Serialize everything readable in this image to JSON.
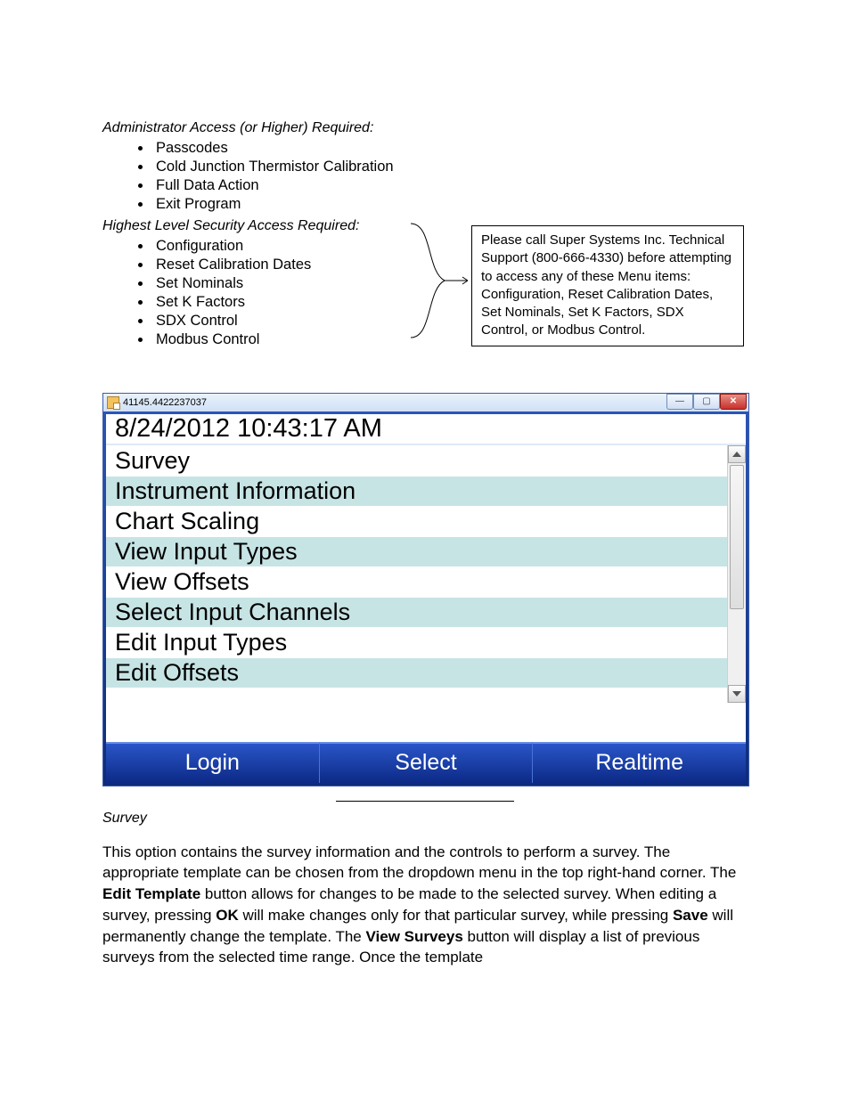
{
  "section1": {
    "heading": "Administrator Access (or Higher) Required:",
    "items": [
      "Passcodes",
      "Cold Junction Thermistor Calibration",
      "Full Data Action",
      "Exit Program"
    ]
  },
  "section2": {
    "heading": "Highest Level Security Access Required:",
    "items": [
      "Configuration",
      "Reset Calibration Dates",
      "Set Nominals",
      "Set K Factors",
      "SDX Control",
      "Modbus Control"
    ]
  },
  "callout": "Please call Super Systems Inc. Technical Support (800-666-4330) before attempting to access any of these Menu items: Configuration, Reset Calibration Dates, Set Nominals, Set K Factors, SDX Control, or Modbus Control.",
  "app": {
    "window_title": "41145.4422237037",
    "datetime": "8/24/2012 10:43:17 AM",
    "menu_items": [
      "Survey",
      "Instrument Information",
      "Chart Scaling",
      "View Input Types",
      "View Offsets",
      "Select Input Channels",
      "Edit Input Types",
      "Edit Offsets"
    ],
    "buttons": {
      "login": "Login",
      "select": "Select",
      "realtime": "Realtime"
    }
  },
  "survey": {
    "heading": "Survey",
    "p1a": "This option contains the survey information and the controls to perform a survey.  The appropriate template can be chosen from the dropdown menu in the top right-hand corner.  The ",
    "b1": "Edit Template",
    "p1b": " button allows for changes to be made to the selected survey. When editing a survey, pressing ",
    "b2": "OK",
    "p1c": " will make changes only for that particular survey, while pressing ",
    "b3": "Save",
    "p1d": " will permanently change the template.  The ",
    "b4": "View Surveys",
    "p1e": " button will display a list of previous surveys from the selected time range.  Once the template"
  }
}
